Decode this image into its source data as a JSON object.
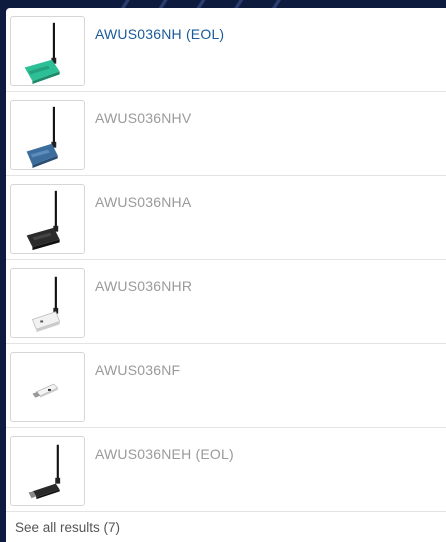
{
  "results": [
    {
      "label": "AWUS036NH (EOL)",
      "active": true,
      "image": "green-usb-wifi-adapter-with-antenna"
    },
    {
      "label": "AWUS036NHV",
      "active": false,
      "image": "blue-usb-wifi-adapter-with-antenna"
    },
    {
      "label": "AWUS036NHA",
      "active": false,
      "image": "black-usb-wifi-adapter-with-antenna"
    },
    {
      "label": "AWUS036NHR",
      "active": false,
      "image": "white-usb-wifi-adapter-with-antenna"
    },
    {
      "label": "AWUS036NF",
      "active": false,
      "image": "white-usb-nano-wifi-adapter"
    },
    {
      "label": "AWUS036NEH (EOL)",
      "active": false,
      "image": "black-usb-stick-wifi-adapter-with-antenna"
    }
  ],
  "see_all": "See all results (7)",
  "colors": {
    "active_link": "#1a5a9a",
    "inactive_text": "#9a9a9a",
    "background": "#0d1b3e"
  }
}
